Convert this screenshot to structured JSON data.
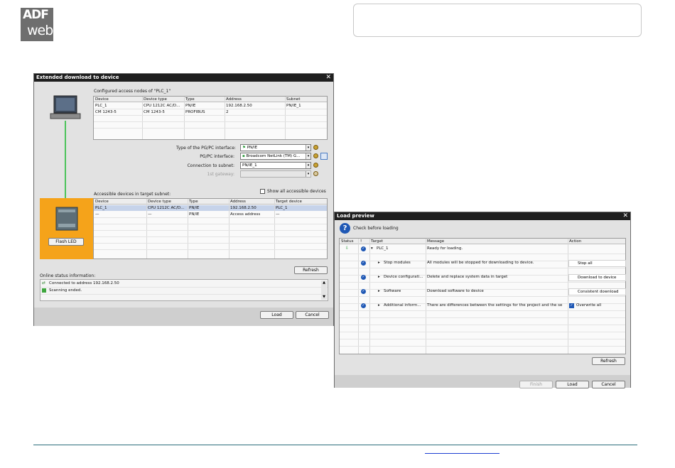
{
  "logo": {
    "line1": "ADF",
    "line2": "web"
  },
  "download_dialog": {
    "title": "Extended download to device",
    "configured_label": "Configured access nodes of \"PLC_1\"",
    "configured_headers": [
      "Device",
      "Device type",
      "Type",
      "Address",
      "Subnet"
    ],
    "configured_rows": [
      [
        "PLC_1",
        "CPU 1212C AC/D...",
        "PN/IE",
        "192.168.2.50",
        "PN/IE_1"
      ],
      [
        "CM 1243-5",
        "CM 1243-5",
        "PROFIBUS",
        "2",
        ""
      ]
    ],
    "pgpc_type_label": "Type of the PG/PC interface:",
    "pgpc_type_value": "PN/IE",
    "pgpc_if_label": "PG/PC interface:",
    "pgpc_if_value": "Broadcom NetLink (TM) G...",
    "subnet_label": "Connection to subnet:",
    "subnet_value": "PN/IE_1",
    "gateway_label": "1st gateway:",
    "gateway_value": "",
    "show_all_label": "Show all accessible devices",
    "accessible_label": "Accessible devices in target subnet:",
    "accessible_headers": [
      "Device",
      "Device type",
      "Type",
      "Address",
      "Target device"
    ],
    "accessible_rows": [
      [
        "PLC_1",
        "CPU 1212C AC/D...",
        "PN/IE",
        "192.168.2.50",
        "PLC_1"
      ],
      [
        "—",
        "—",
        "PN/IE",
        "Access address",
        "—"
      ]
    ],
    "flash_led": "Flash LED",
    "refresh": "Refresh",
    "online_label": "Online status information:",
    "status_lines": [
      "Connected to address 192.168.2.50",
      "Scanning ended."
    ],
    "load": "Load",
    "cancel": "Cancel"
  },
  "load_preview": {
    "title": "Load preview",
    "check_label": "Check before loading",
    "headers": [
      "Status",
      "!",
      "Target",
      "Message",
      "Action"
    ],
    "rows": [
      {
        "target": "PLC_1",
        "message": "Ready for loading.",
        "action": ""
      },
      {
        "target": "Stop modules",
        "message": "All modules will be stopped for downloading to device.",
        "action": "Stop all"
      },
      {
        "target": "Device configurati...",
        "message": "Delete and replace system data in target",
        "action": "Download to device"
      },
      {
        "target": "Software",
        "message": "Download software to device",
        "action": "Consistent download"
      },
      {
        "target": "Additional inform...",
        "message": "There are differences between the settings for the project and the se",
        "action": "Overwrite all"
      }
    ],
    "refresh": "Refresh",
    "finish": "Finish",
    "load": "Load",
    "cancel": "Cancel"
  },
  "colors": {
    "title_bar": "#1f1f1f",
    "led_panel": "#f5a31a",
    "link_line": "#1c3fd1",
    "footer_line": "#2b6f7c"
  }
}
